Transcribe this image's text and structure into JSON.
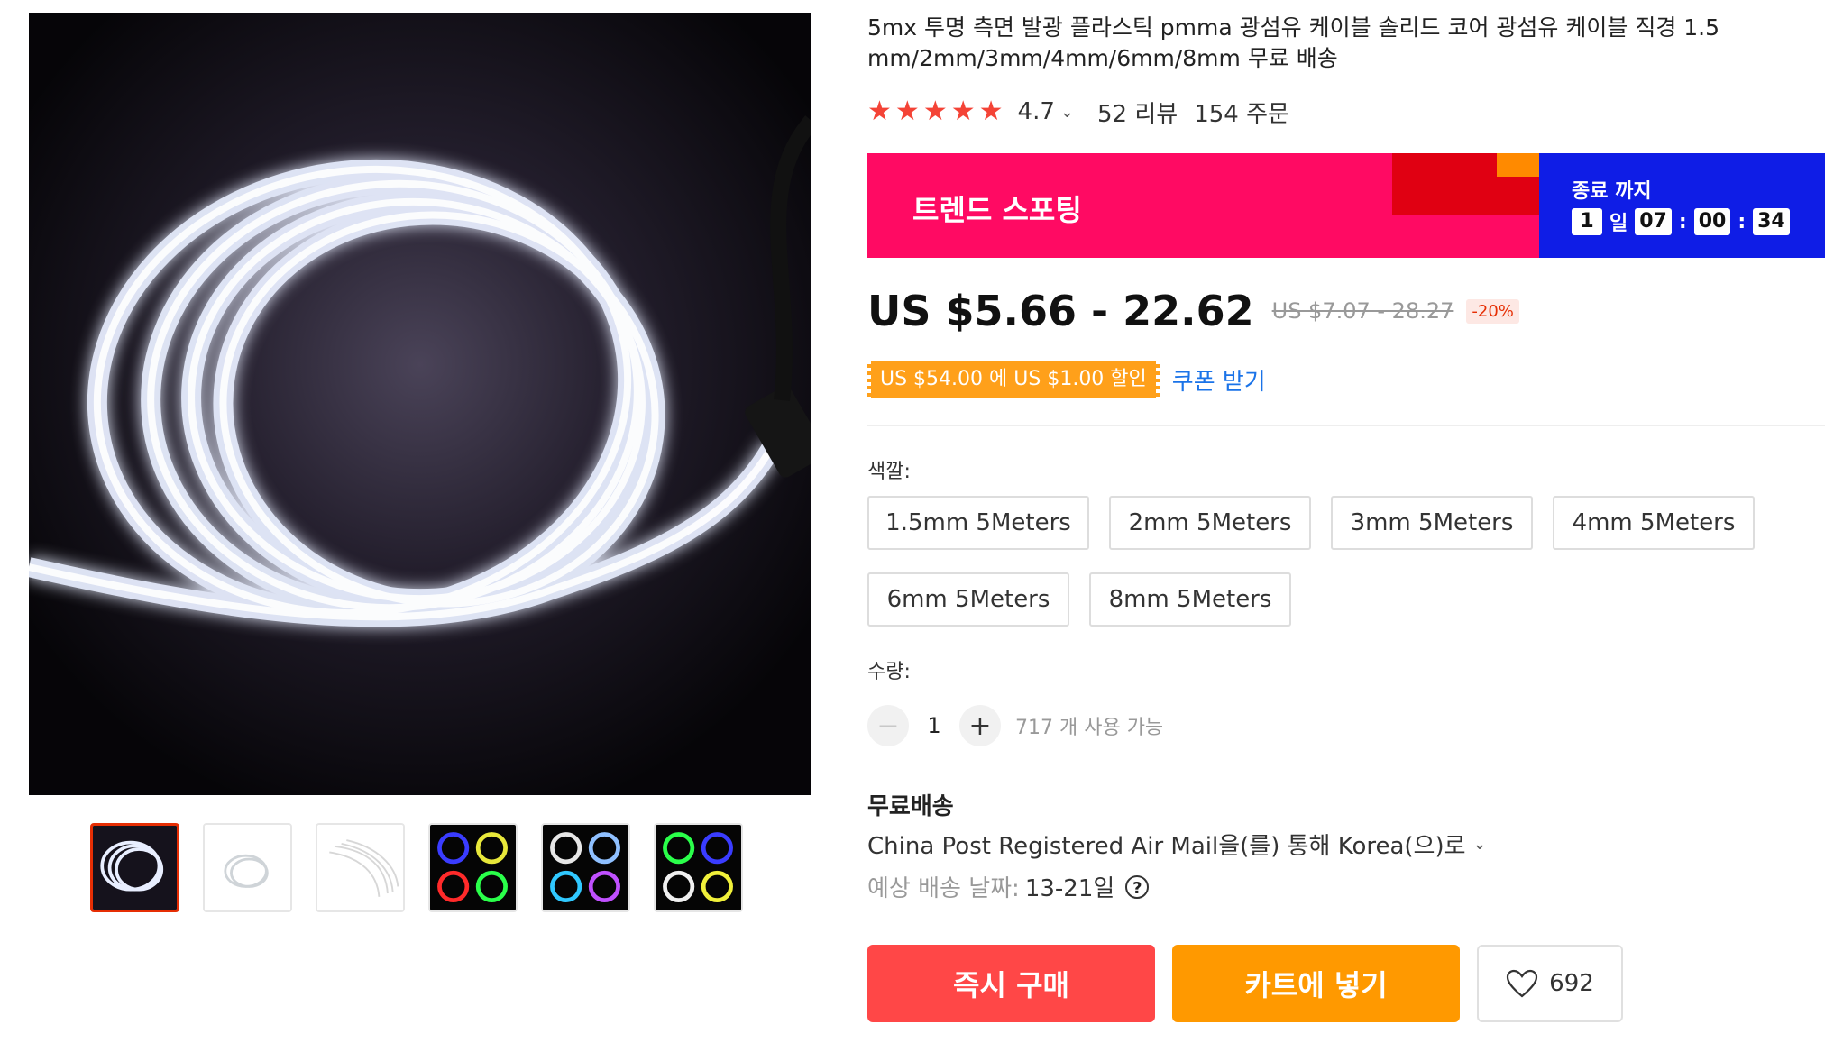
{
  "product": {
    "title": "5mx 투명 측면 발광 플라스틱 pmma 광섬유 케이블 솔리드 코어 광섬유 케이블 직경 1.5 mm/2mm/3mm/4mm/6mm/8mm 무료 배송",
    "rating_stars": 5,
    "rating_value": "4.7",
    "reviews": "52 리뷰",
    "orders": "154 주문"
  },
  "promo": {
    "label": "트렌드 스포팅",
    "until_label": "종료 까지",
    "countdown": {
      "days": "1",
      "day_unit": "일",
      "hours": "07",
      "minutes": "00",
      "seconds": "34"
    },
    "colors": {
      "left_bg": "#ff0a63",
      "right_bg": "#0f1de6"
    }
  },
  "price": {
    "current": "US $5.66 - 22.62",
    "original": "US $7.07 - 28.27",
    "discount": "-20%"
  },
  "coupon": {
    "tag": "US $54.00 에 US $1.00 할인",
    "link": "쿠폰 받기"
  },
  "color_selector": {
    "label": "색깔:",
    "options": [
      "1.5mm 5Meters",
      "2mm 5Meters",
      "3mm 5Meters",
      "4mm 5Meters",
      "6mm 5Meters",
      "8mm 5Meters"
    ]
  },
  "quantity": {
    "label": "수량:",
    "value": "1",
    "available": "717 개 사용 가능"
  },
  "shipping": {
    "title": "무료배송",
    "method": "China Post Registered Air Mail을(를) 통해 Korea(으)로",
    "date_label": "예상 배송 날짜:",
    "date_value": "13-21일"
  },
  "actions": {
    "buy_now": "즉시 구매",
    "add_to_cart": "카트에 넣기",
    "wishlist_count": "692"
  },
  "thumbnails": [
    "white-coil",
    "white-coil-small",
    "white-strands",
    "blue-yellow-red-green",
    "white-blue-cyan-purple",
    "green-blue-white-yellow"
  ],
  "icons": {
    "star": "star-icon",
    "chevron": "chevron-down-icon",
    "help": "help-circle-icon",
    "heart": "heart-icon",
    "minus": "minus-icon",
    "plus": "plus-icon"
  }
}
